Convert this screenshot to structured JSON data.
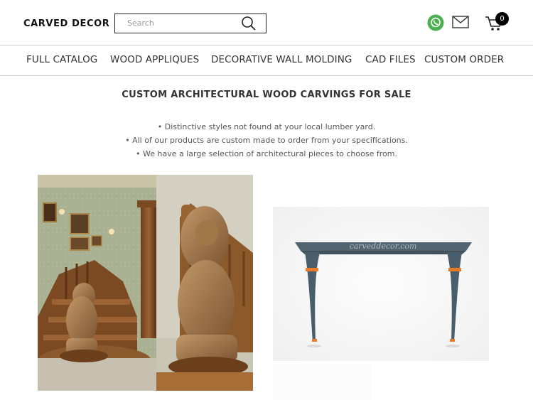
{
  "header": {
    "logo": "CARVED DECOR",
    "search_placeholder": "Search",
    "cart_count": "0"
  },
  "nav": {
    "items": [
      "FULL CATALOG",
      "WOOD APPLIQUES",
      "DECORATIVE WALL MOLDING",
      "CAD FILES",
      "CUSTOM ORDER"
    ]
  },
  "main": {
    "heading": "CUSTOM ARCHITECTURAL WOOD CARVINGS FOR SALE",
    "bullets": [
      "• Distinctive styles not found at your local lumber yard.",
      "• All of our products are custom made to order from your specifications.",
      "• We have a large selection of architectural pieces to choose from."
    ],
    "watermark": "carveddecor.com"
  },
  "icons": [
    "search-icon",
    "whatsapp-icon",
    "mail-icon",
    "cart-icon"
  ],
  "colors": {
    "whatsapp": "#4CAF50",
    "cart_badge": "#000000",
    "console_table": "#4A5D6B",
    "console_accent": "#E87A2A",
    "wood": "#8B5A2B",
    "wall": "#A9B192"
  }
}
